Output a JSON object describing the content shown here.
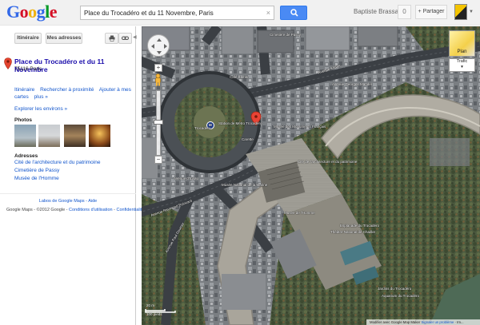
{
  "header": {
    "logo": [
      "G",
      "o",
      "o",
      "g",
      "l",
      "e"
    ],
    "logo_colors": [
      "#3369e8",
      "#d50f25",
      "#eeb211",
      "#3369e8",
      "#009925",
      "#d50f25"
    ],
    "search_value": "Place du Trocadéro et du 11 Novembre, Paris",
    "search_clear": "×",
    "search_button_icon": "search-icon",
    "user_name": "Baptiste Brassart",
    "notifications": "0",
    "share_label": "+ Partager"
  },
  "panel": {
    "itinerary_button": "Itinéraire",
    "my_addresses_button": "Mes adresses",
    "print_icon": "print-icon",
    "link_icon": "link-icon",
    "collapse_icon": "collapse-left-icon",
    "place_title": "Place du Trocadéro et du 11 Novembre",
    "place_address": "75116 Paris",
    "actions": [
      "Itinéraire",
      "Rechercher à proximité",
      "Ajouter à mes cartes",
      "plus »"
    ],
    "explore_link": "Explorer les environs »",
    "photos_heading": "Photos",
    "addresses_heading": "Adresses",
    "addresses": [
      "Cité de l'architecture et du patrimoine",
      "Cimetière de Passy",
      "Musée de l'Homme"
    ],
    "labs_line": "Labos de Google Maps - Aide",
    "footer_text": "Google Maps - ©2012 Google - ",
    "footer_link1": "Conditions d'utilisation",
    "footer_sep": " - ",
    "footer_link2": "Confidentialité"
  },
  "map": {
    "labels": {
      "cafe": "Café Kléber",
      "avenue_kleber": "Avenue Kléber",
      "trocadero": "Trocadéro",
      "metro": "M",
      "station": "Station de Métro Trocadéro",
      "carette": "Carette",
      "monuments": "Musée des Monuments Français",
      "architecture": "Cité de l'architecture et du patrimoine",
      "passy": "Cimetière de Passy",
      "georges_mandel": "Avenue Georges Mandel",
      "homme": "Musée de l'Homme",
      "marine": "Musée National de la Marine",
      "eylau": "Avenue d'Eylau",
      "poincare": "Avenue Raymond Poincaré",
      "wilson": "Avenue du Président Wilson",
      "paul_doumer": "Avenue Paul Doumer",
      "jardins": "Jardins du Trocadéro",
      "place_name": "Place du Trocadéro et du 11 Novembre",
      "esplanade": "Esplanade du Trocadéro",
      "resistants": "Les Résistants",
      "aquarium": "Aquarium du Trocadéro",
      "theatre": "Théâtre National de Chaillot",
      "new_york": "Avenue de New York",
      "albert": "Avenue Albert de Mun",
      "hong_kong": "Cinéaqua"
    },
    "plan_label": "Plan",
    "traffic_label": "Trafic",
    "traffic_caret": "▾",
    "zoom_in": "+",
    "zoom_out": "−",
    "scale_metric": "20 m",
    "scale_imperial": "100 pieds",
    "attribution_prefix": "Modifier avec Google Map Maker ",
    "attribution_link": "Signaler un problème",
    "attribution_suffix": " · Im..."
  }
}
